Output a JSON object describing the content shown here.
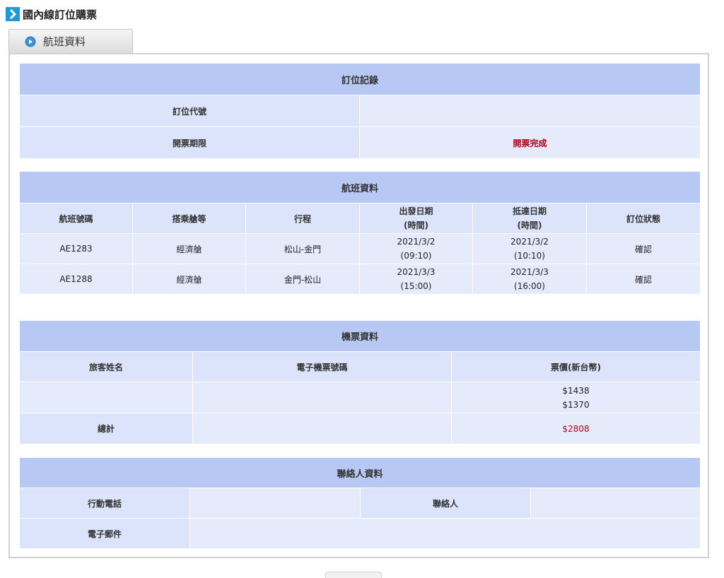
{
  "page": {
    "title": "國內線訂位購票"
  },
  "tab": {
    "label": "航班資料"
  },
  "booking": {
    "title": "訂位記錄",
    "code_label": "訂位代號",
    "code_value": "",
    "deadline_label": "開票期限",
    "deadline_value": "開票完成"
  },
  "flights": {
    "title": "航班資料",
    "headers": [
      "航班號碼",
      "搭乘艙等",
      "行程",
      "出發日期\n(時間)",
      "抵達日期\n(時間)",
      "訂位狀態"
    ],
    "rows": [
      {
        "flight_no": "AE1283",
        "cabin": "經濟艙",
        "route": "松山-金門",
        "depart_date": "2021/3/2",
        "depart_time": "(09:10)",
        "arrive_date": "2021/3/2",
        "arrive_time": "(10:10)",
        "status": "確認"
      },
      {
        "flight_no": "AE1288",
        "cabin": "經濟艙",
        "route": "金門-松山",
        "depart_date": "2021/3/3",
        "depart_time": "(15:00)",
        "arrive_date": "2021/3/3",
        "arrive_time": "(16:00)",
        "status": "確認"
      }
    ]
  },
  "tickets": {
    "title": "機票資料",
    "headers": [
      "旅客姓名",
      "電子機票號碼",
      "票價(新台幣)"
    ],
    "passenger_name": "",
    "ticket_number": "",
    "prices": [
      "$1438",
      "$1370"
    ],
    "total_label": "總計",
    "total_value": "$2808"
  },
  "contact": {
    "title": "聯絡人資料",
    "phone_label": "行動電話",
    "phone_value": "",
    "contact_label": "聯絡人",
    "contact_value": "",
    "email_label": "電子郵件",
    "email_value": ""
  }
}
